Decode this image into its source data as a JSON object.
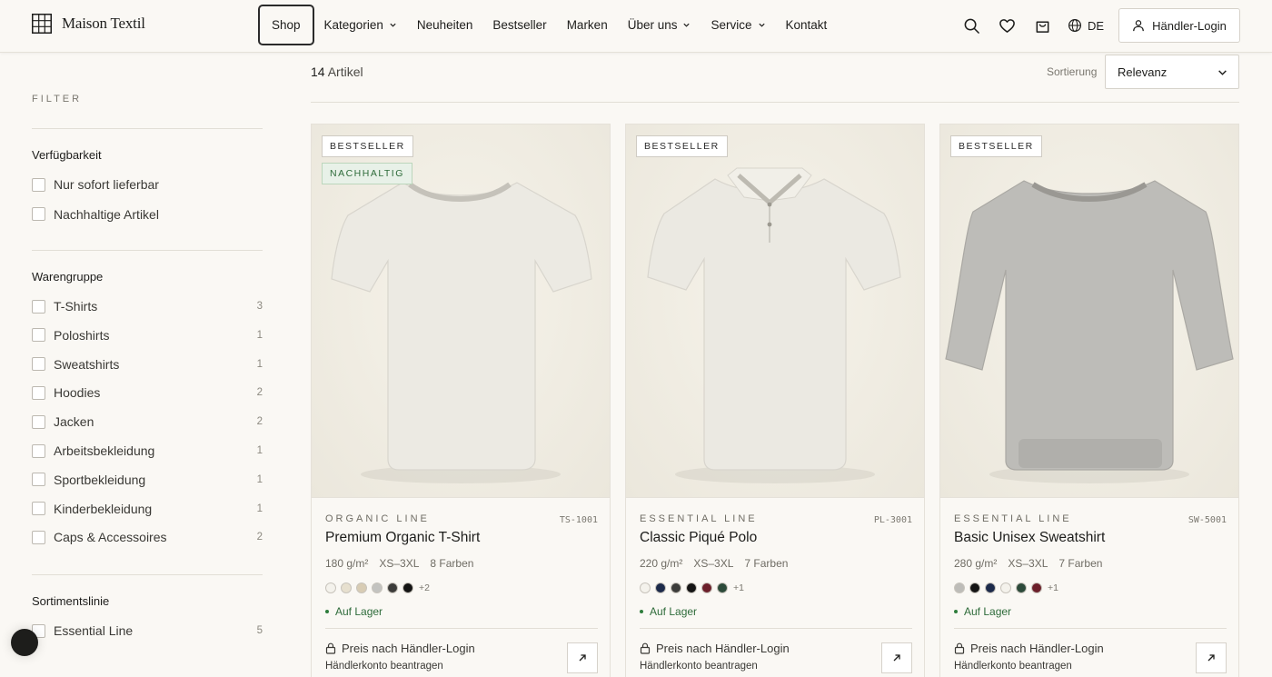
{
  "header": {
    "logo_text": "Maison Textil",
    "nav": [
      {
        "label": "Shop",
        "dropdown": false,
        "active": true
      },
      {
        "label": "Kategorien",
        "dropdown": true,
        "active": false
      },
      {
        "label": "Neuheiten",
        "dropdown": false,
        "active": false
      },
      {
        "label": "Bestseller",
        "dropdown": false,
        "active": false
      },
      {
        "label": "Marken",
        "dropdown": false,
        "active": false
      },
      {
        "label": "Über uns",
        "dropdown": true,
        "active": false
      },
      {
        "label": "Service",
        "dropdown": true,
        "active": false
      },
      {
        "label": "Kontakt",
        "dropdown": false,
        "active": false
      }
    ],
    "icons": [
      "search-icon",
      "heart-icon",
      "cart-icon"
    ],
    "language": "DE",
    "login_label": "Händler-Login"
  },
  "sidebar": {
    "title": "FILTER",
    "groups": [
      {
        "title": "Verfügbarkeit",
        "items": [
          {
            "label": "Nur sofort lieferbar",
            "count": ""
          },
          {
            "label": "Nachhaltige Artikel",
            "count": ""
          }
        ]
      },
      {
        "title": "Warengruppe",
        "items": [
          {
            "label": "T-Shirts",
            "count": "3"
          },
          {
            "label": "Poloshirts",
            "count": "1"
          },
          {
            "label": "Sweatshirts",
            "count": "1"
          },
          {
            "label": "Hoodies",
            "count": "2"
          },
          {
            "label": "Jacken",
            "count": "2"
          },
          {
            "label": "Arbeitsbekleidung",
            "count": "1"
          },
          {
            "label": "Sportbekleidung",
            "count": "1"
          },
          {
            "label": "Kinderbekleidung",
            "count": "1"
          },
          {
            "label": "Caps & Accessoires",
            "count": "2"
          }
        ]
      },
      {
        "title": "Sortimentslinie",
        "items": [
          {
            "label": "Essential Line",
            "count": "5"
          }
        ]
      }
    ]
  },
  "main": {
    "count_number": "14",
    "count_label": "Artikel",
    "sort_label": "Sortierung",
    "sort_value": "Relevanz"
  },
  "products": [
    {
      "badges": [
        {
          "text": "BESTSELLER",
          "style": "default"
        },
        {
          "text": "NACHHALTIG",
          "style": "green"
        }
      ],
      "garment": "tshirt",
      "garment_color": "#eceae3",
      "line": "ORGANIC LINE",
      "sku": "TS-1001",
      "name": "Premium Organic T-Shirt",
      "specs": [
        "180 g/m²",
        "XS–3XL",
        "8 Farben"
      ],
      "swatches": [
        "#f4f2ec",
        "#e7e0cf",
        "#d8ccb4",
        "#c3c3c0",
        "#3c3c3a",
        "#141414"
      ],
      "more": "+2",
      "stock": "Auf Lager",
      "price_text": "Preis nach Händler-Login",
      "account_text": "Händlerkonto beantragen"
    },
    {
      "badges": [
        {
          "text": "BESTSELLER",
          "style": "default"
        }
      ],
      "garment": "polo",
      "garment_color": "#ebe9e2",
      "line": "ESSENTIAL LINE",
      "sku": "PL-3001",
      "name": "Classic Piqué Polo",
      "specs": [
        "220 g/m²",
        "XS–3XL",
        "7 Farben"
      ],
      "swatches": [
        "#f4f2ec",
        "#1c2a4a",
        "#3c3c3a",
        "#141414",
        "#6b1f2a",
        "#2c4a3a"
      ],
      "more": "+1",
      "stock": "Auf Lager",
      "price_text": "Preis nach Händler-Login",
      "account_text": "Händlerkonto beantragen"
    },
    {
      "badges": [
        {
          "text": "BESTSELLER",
          "style": "default"
        }
      ],
      "garment": "sweatshirt",
      "garment_color": "#bdbcb8",
      "line": "ESSENTIAL LINE",
      "sku": "SW-5001",
      "name": "Basic Unisex Sweatshirt",
      "specs": [
        "280 g/m²",
        "XS–3XL",
        "7 Farben"
      ],
      "swatches": [
        "#bdbcb8",
        "#141414",
        "#1c2a4a",
        "#f4f2ec",
        "#2c4a3a",
        "#6b1f2a"
      ],
      "more": "+1",
      "stock": "Auf Lager",
      "price_text": "Preis nach Händler-Login",
      "account_text": "Händlerkonto beantragen"
    }
  ]
}
